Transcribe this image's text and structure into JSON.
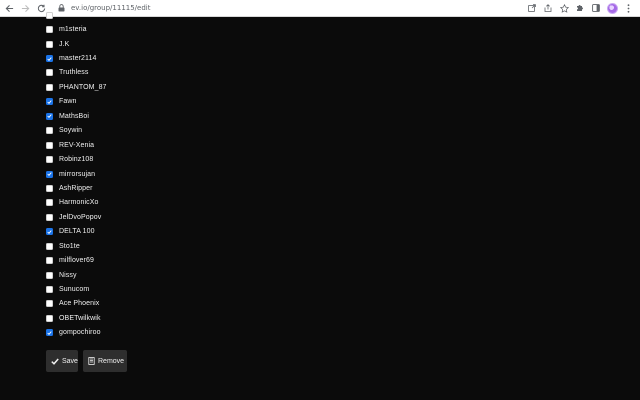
{
  "browser": {
    "url": "ev.io/group/11115/edit"
  },
  "members": [
    {
      "name": "",
      "checked": false
    },
    {
      "name": "m1steria",
      "checked": false
    },
    {
      "name": "J.K",
      "checked": false
    },
    {
      "name": "master2114",
      "checked": true
    },
    {
      "name": "Truthless",
      "checked": false
    },
    {
      "name": "PHANTOM_87",
      "checked": false
    },
    {
      "name": "Fawn",
      "checked": true
    },
    {
      "name": "MathsBoi",
      "checked": true
    },
    {
      "name": "Soywin",
      "checked": false
    },
    {
      "name": "REV-Xenia",
      "checked": false
    },
    {
      "name": "Robinz108",
      "checked": false
    },
    {
      "name": "mirrorsujan",
      "checked": true
    },
    {
      "name": "AshRipper",
      "checked": false
    },
    {
      "name": "HarmonicXo",
      "checked": false
    },
    {
      "name": "JelDvoPopov",
      "checked": false
    },
    {
      "name": "DELTA 100",
      "checked": true
    },
    {
      "name": "Sto1te",
      "checked": false
    },
    {
      "name": "milflover69",
      "checked": false
    },
    {
      "name": "Nissy",
      "checked": false
    },
    {
      "name": "Sunucom",
      "checked": false
    },
    {
      "name": "Ace Phoenix",
      "checked": false
    },
    {
      "name": "OBETwilkwik",
      "checked": false
    },
    {
      "name": "gompochiroo",
      "checked": true
    }
  ],
  "actions": {
    "save_label": "Save",
    "delete_label": "Remove"
  },
  "colors": {
    "background": "#0b0b0b",
    "button": "#2e2e2e",
    "checkbox_checked": "#1a73e8"
  }
}
